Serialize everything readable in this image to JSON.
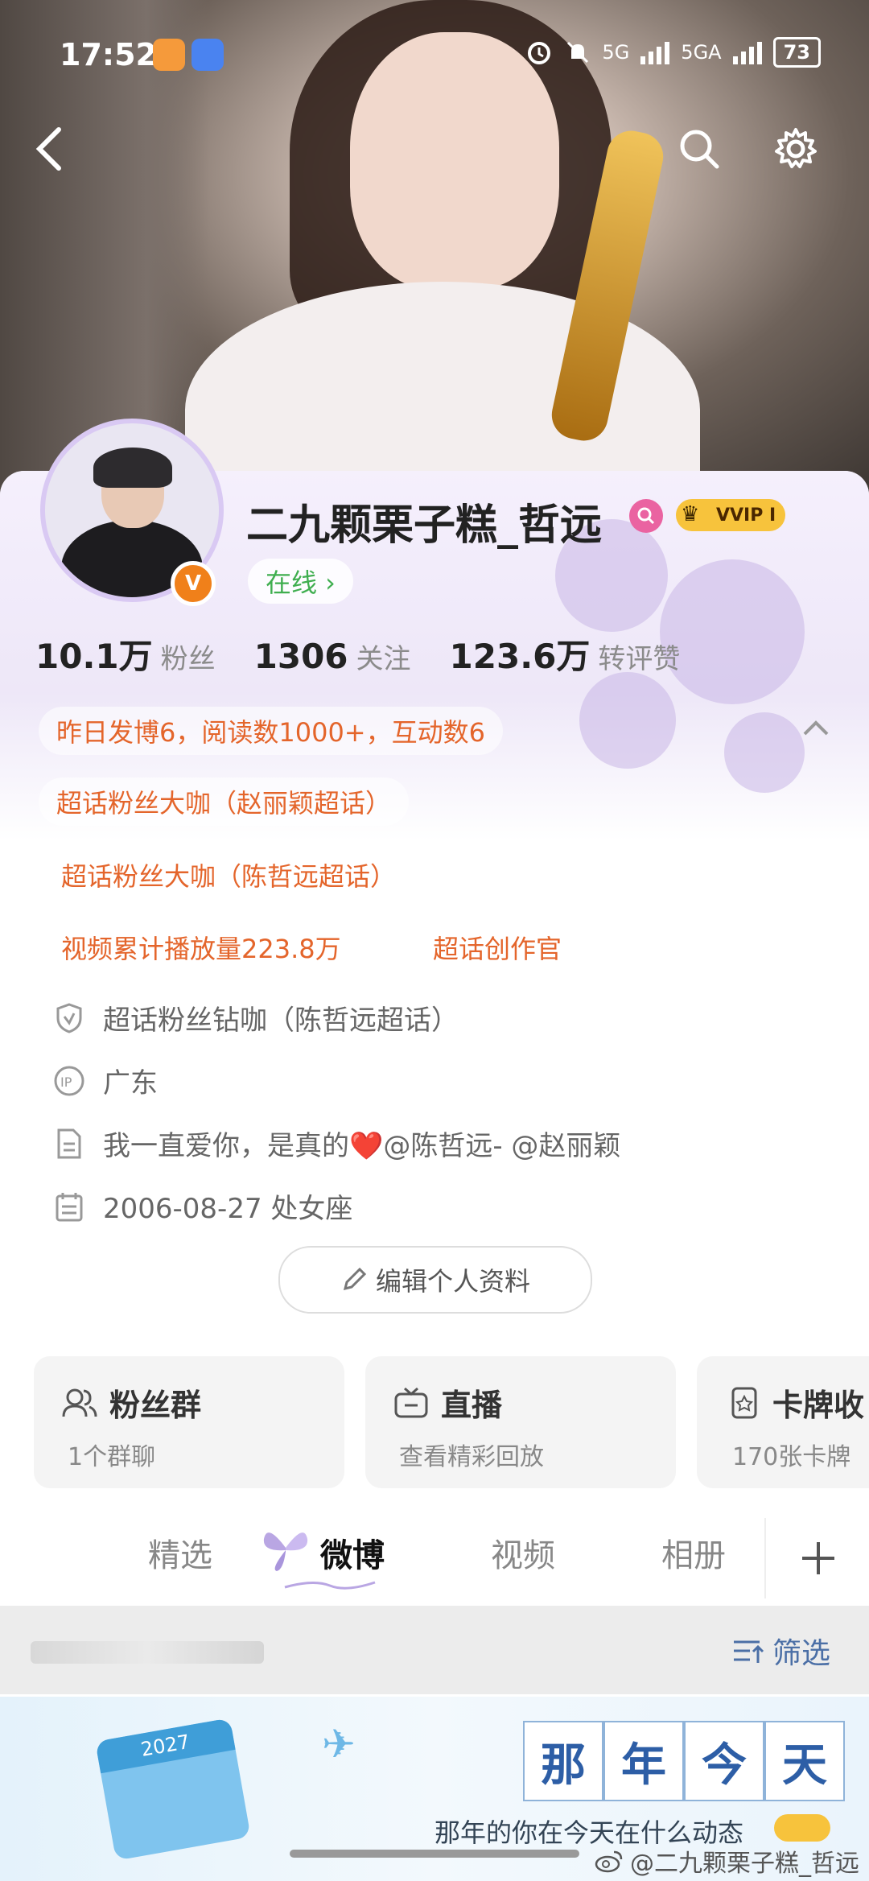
{
  "status_bar": {
    "time": "17:52",
    "network": "5G",
    "network2": "5GA",
    "battery": "73"
  },
  "profile": {
    "username": "二九颗栗子糕_哲远",
    "vip_label": "VVIP I",
    "online_label": "在线 ›",
    "stats": [
      {
        "value": "10.1万",
        "label": "粉丝"
      },
      {
        "value": "1306",
        "label": "关注"
      },
      {
        "value": "123.6万",
        "label": "转评赞"
      }
    ],
    "yesterday_summary": "昨日发博6，阅读数1000+，互动数6",
    "achievements": [
      "超话粉丝大咖（赵丽颖超话）",
      "超话粉丝大咖（陈哲远超话）",
      "视频累计播放量223.8万",
      "超话创作官"
    ],
    "info": {
      "badge": "超话粉丝钻咖（陈哲远超话）",
      "ip": "广东",
      "bio": "我一直爱你，是真的❤️@陈哲远- @赵丽颖",
      "birthday": "2006-08-27 处女座"
    },
    "edit_button": "编辑个人资料"
  },
  "tiles": [
    {
      "title": "粉丝群",
      "sub": "1个群聊",
      "icon": "group-icon"
    },
    {
      "title": "直播",
      "sub": "查看精彩回放",
      "icon": "tv-icon"
    },
    {
      "title": "卡牌收",
      "sub": "170张卡牌",
      "icon": "card-icon"
    }
  ],
  "tabs": [
    "精选",
    "微博",
    "视频",
    "相册"
  ],
  "active_tab": "微博",
  "filter_label": "筛选",
  "banner": {
    "chars": [
      "那",
      "年",
      "今",
      "天"
    ],
    "calendar_year": "2027",
    "subtitle": "那年的你在今天在什么动态"
  },
  "watermark": "@二九颗栗子糕_哲远",
  "colors": {
    "accent_orange": "#e4652b",
    "online_green": "#3fae4f",
    "vip_gold": "#f7c33c",
    "filter_blue": "#4b6fa6"
  }
}
